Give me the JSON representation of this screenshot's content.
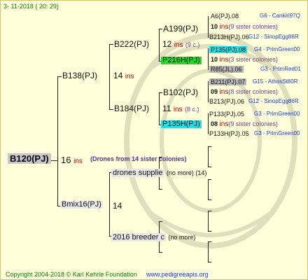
{
  "header": {
    "date": "3- 11-2018 ( 20: 29)"
  },
  "root": {
    "label": "B120(PJ)",
    "gen": "16",
    "ins": "ins",
    "note": "(Drones from 14 sister colonies)"
  },
  "sire": {
    "label": "B138(PJ)",
    "gen": "14",
    "ins": "ins"
  },
  "dam": {
    "label": "Bmix16(PJ)",
    "gen": "14"
  },
  "sire_sire": {
    "label": "B222(PJ)",
    "gen": "12",
    "ins": "ins",
    "col": "(9 c.)"
  },
  "sire_dam": {
    "label": "B184(PJ)",
    "gen": "11",
    "ins": "ins",
    "col": "(8 c.)"
  },
  "ss_sire": {
    "label": "A199(PJ)",
    "gen": "10",
    "ins": "ins",
    "col": "(9 sister colonies)"
  },
  "ss_dam": {
    "label": "P216H(PJ)",
    "gen": "10",
    "ins": "ins",
    "col": "(3 sister colonies)"
  },
  "sd_sire": {
    "label": "B102(PJ)",
    "gen": "09",
    "ins": "ins",
    "col": "(8 sister colonies)"
  },
  "sd_dam": {
    "label": "P135H(PJ)",
    "gen": "08",
    "ins": "ins",
    "col": "(9 sister colonies)"
  },
  "gg": [
    {
      "label": "A6(PJ).08",
      "group": "G6 - Cankiri97Q"
    },
    {
      "label": "B213H(PJ).06",
      "group": "G12 - SinopEgg86R"
    },
    {
      "label": "P135(PJ).08",
      "group": "G4 - PrimGreen00"
    },
    {
      "label": "R85(JL).06",
      "group": "G3 - PrimRed01"
    },
    {
      "label": "B211(PJ).07",
      "group": "G15 - AthosSt80R"
    },
    {
      "label": "B213(PJ).06",
      "group": "G12 - SinopEgg86R"
    },
    {
      "label": "P133(PJ).05",
      "group": "G3 - PrimGreen00"
    },
    {
      "label": "P133H(PJ).05",
      "group": "G3 - PrimGreen00"
    }
  ],
  "dam_sire": {
    "label": "drones supplie",
    "note": "(no more) (14)"
  },
  "dam_dam": {
    "label": "2016 breeder c",
    "note": "(no more)"
  },
  "footer": {
    "copyright": "Copyright 2004-2018 © Karl Kehrle Foundation",
    "site": "www.pedigreeapis.org"
  },
  "colors": {
    "background": "#ffffd9",
    "green_highlight": "#22dd22",
    "cyan_highlight": "#22e0e6",
    "group_text": "#1a3fc4",
    "ins_text": "#c00000"
  }
}
